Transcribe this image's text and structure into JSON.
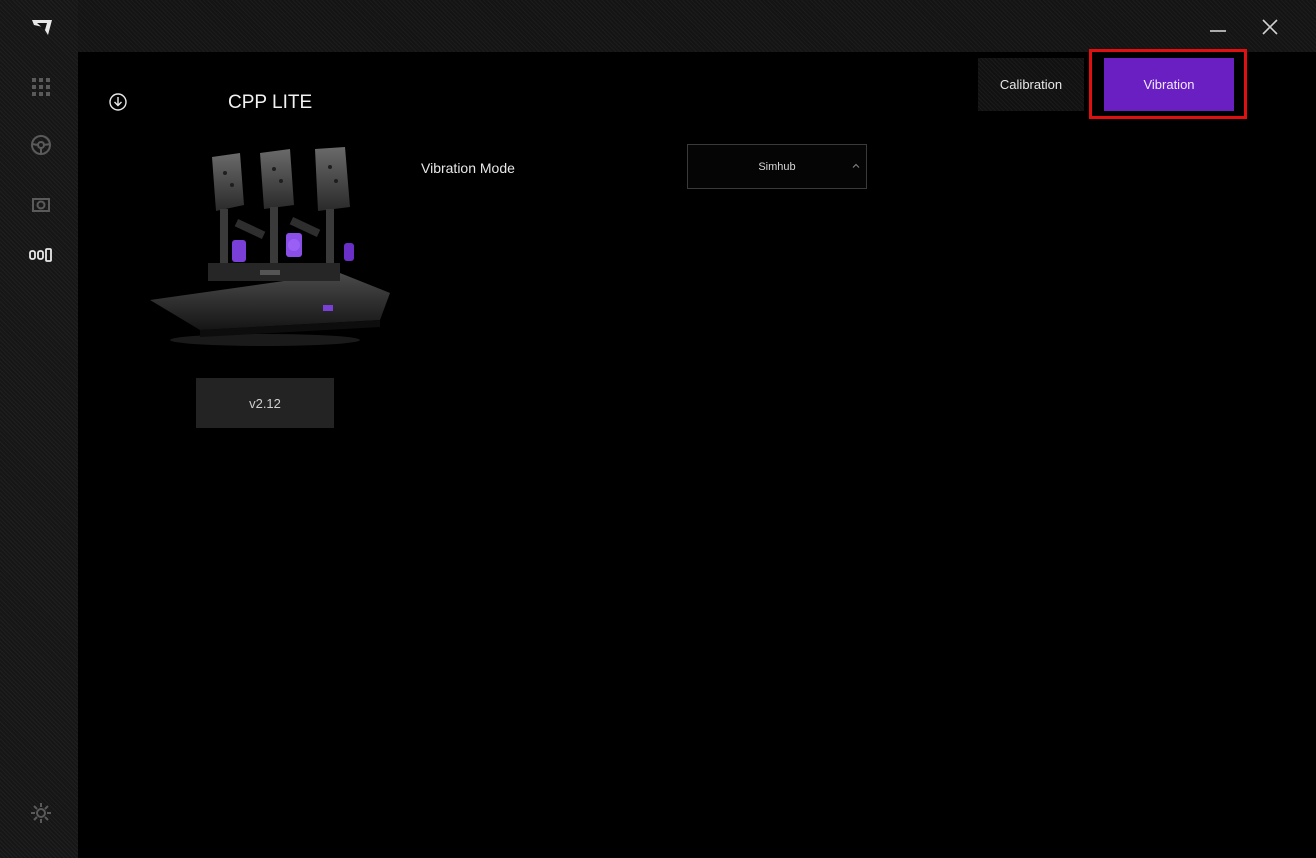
{
  "app": {
    "logo_icon": "app-logo-icon",
    "window_controls": {
      "minimize_icon": "minimize-icon",
      "close_icon": "close-icon"
    }
  },
  "sidebar": {
    "items": [
      {
        "icon": "grid-icon"
      },
      {
        "icon": "steering-wheel-icon"
      },
      {
        "icon": "wheel-base-icon"
      },
      {
        "icon": "pedals-icon",
        "active": true
      }
    ],
    "settings_icon": "gear-icon"
  },
  "device": {
    "name": "CPP LITE",
    "download_icon": "download-icon",
    "firmware_version": "v2.12"
  },
  "tabs": [
    {
      "label": "Calibration",
      "active": false
    },
    {
      "label": "Vibration",
      "active": true
    }
  ],
  "vibration": {
    "mode_label": "Vibration Mode",
    "mode_value": "Simhub"
  },
  "colors": {
    "accent": "#6a1fc2",
    "highlight": "#e01010",
    "background": "#000000"
  }
}
